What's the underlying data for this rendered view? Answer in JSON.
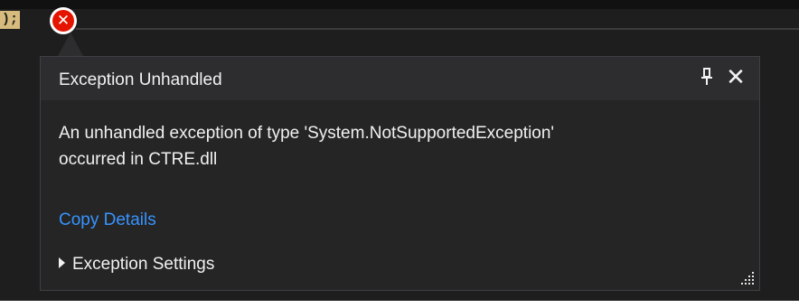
{
  "editor": {
    "code_fragment": ");"
  },
  "error_glyph": {
    "icon": "error-x-icon",
    "symbol": "✕",
    "color": "#e51400"
  },
  "popup": {
    "title": "Exception Unhandled",
    "pin_icon": "pin-icon",
    "pin_symbol": "🖈",
    "close_icon": "close-icon",
    "close_symbol": "✕",
    "message_line1": "An unhandled exception of type 'System.NotSupportedException'",
    "message_line2": "occurred in CTRE.dll",
    "copy_details_label": "Copy Details",
    "exception_settings_label": "Exception Settings",
    "link_color": "#3794ff",
    "background": "#252526"
  }
}
